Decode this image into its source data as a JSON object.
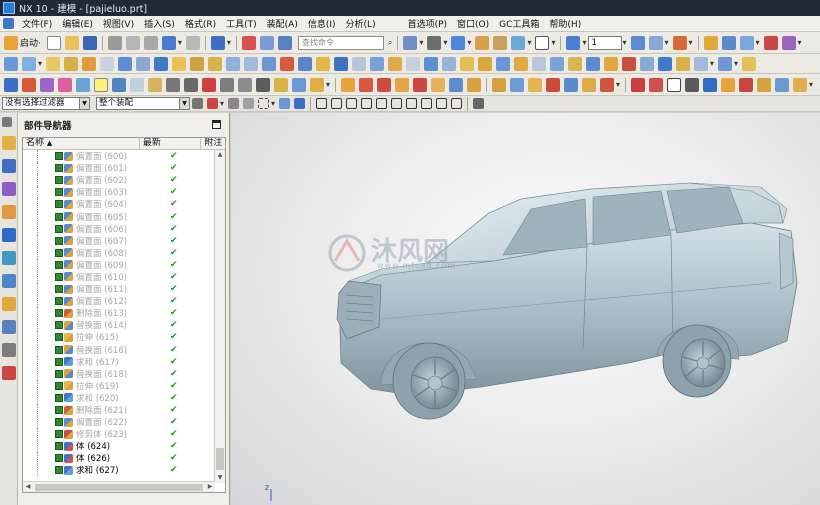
{
  "window": {
    "title": "NX 10 - 建模 - [pajieluo.prt]"
  },
  "menu": [
    "文件(F)",
    "编辑(E)",
    "视图(V)",
    "插入(S)",
    "格式(R)",
    "工具(T)",
    "装配(A)",
    "信息(I)",
    "分析(L)",
    "首选项(P)",
    "窗口(O)",
    "GC工具箱",
    "帮助(H)"
  ],
  "toolbar": {
    "start_label": "启动·",
    "search_placeholder": "查找命令",
    "layer_value": "1"
  },
  "selection_bar": {
    "filter_value": "没有选择过滤器",
    "scope_value": "整个装配"
  },
  "navigator": {
    "title": "部件导航器",
    "columns": {
      "name": "名称",
      "latest": "最新",
      "note": "附注"
    },
    "rows": [
      {
        "label": "偏置面 (600)",
        "state": "suppressed",
        "icon": "offset-face"
      },
      {
        "label": "偏置面 (601)",
        "state": "suppressed",
        "icon": "offset-face"
      },
      {
        "label": "偏置面 (602)",
        "state": "suppressed",
        "icon": "offset-face"
      },
      {
        "label": "偏置面 (603)",
        "state": "suppressed",
        "icon": "offset-face"
      },
      {
        "label": "偏置面 (604)",
        "state": "suppressed",
        "icon": "offset-face"
      },
      {
        "label": "偏置面 (605)",
        "state": "suppressed",
        "icon": "offset-face"
      },
      {
        "label": "偏置面 (606)",
        "state": "suppressed",
        "icon": "offset-face"
      },
      {
        "label": "偏置面 (607)",
        "state": "suppressed",
        "icon": "offset-face"
      },
      {
        "label": "偏置面 (608)",
        "state": "suppressed",
        "icon": "offset-face"
      },
      {
        "label": "偏置面 (609)",
        "state": "suppressed",
        "icon": "offset-face"
      },
      {
        "label": "偏置面 (610)",
        "state": "suppressed",
        "icon": "offset-face"
      },
      {
        "label": "偏置面 (611)",
        "state": "suppressed",
        "icon": "offset-face"
      },
      {
        "label": "偏置面 (612)",
        "state": "suppressed",
        "icon": "offset-face"
      },
      {
        "label": "删除面 (613)",
        "state": "suppressed",
        "icon": "delete-face"
      },
      {
        "label": "替换面 (614)",
        "state": "suppressed",
        "icon": "replace-face"
      },
      {
        "label": "拉伸 (615)",
        "state": "suppressed",
        "icon": "extrude"
      },
      {
        "label": "替换面 (616)",
        "state": "suppressed",
        "icon": "replace-face"
      },
      {
        "label": "求和 (617)",
        "state": "suppressed",
        "icon": "unite"
      },
      {
        "label": "替换面 (618)",
        "state": "suppressed",
        "icon": "replace-face"
      },
      {
        "label": "拉伸 (619)",
        "state": "suppressed",
        "icon": "extrude"
      },
      {
        "label": "求和 (620)",
        "state": "suppressed",
        "icon": "unite"
      },
      {
        "label": "删除面 (621)",
        "state": "suppressed",
        "icon": "delete-face"
      },
      {
        "label": "偏置面 (622)",
        "state": "suppressed",
        "icon": "offset-face"
      },
      {
        "label": "修剪体 (623)",
        "state": "suppressed",
        "icon": "trim-body"
      },
      {
        "label": "体 (624)",
        "state": "active",
        "icon": "body"
      },
      {
        "label": "体 (626)",
        "state": "active",
        "icon": "body"
      },
      {
        "label": "求和 (627)",
        "state": "active",
        "icon": "unite"
      }
    ]
  },
  "viewport": {
    "watermark_text": "沐风网",
    "watermark_url": "www.mfcad.com",
    "axis_label": "Z"
  },
  "colors": {
    "titlebar": "#1f2a36",
    "checkmark": "#1f9a1f",
    "model": "#b9cdd5"
  }
}
